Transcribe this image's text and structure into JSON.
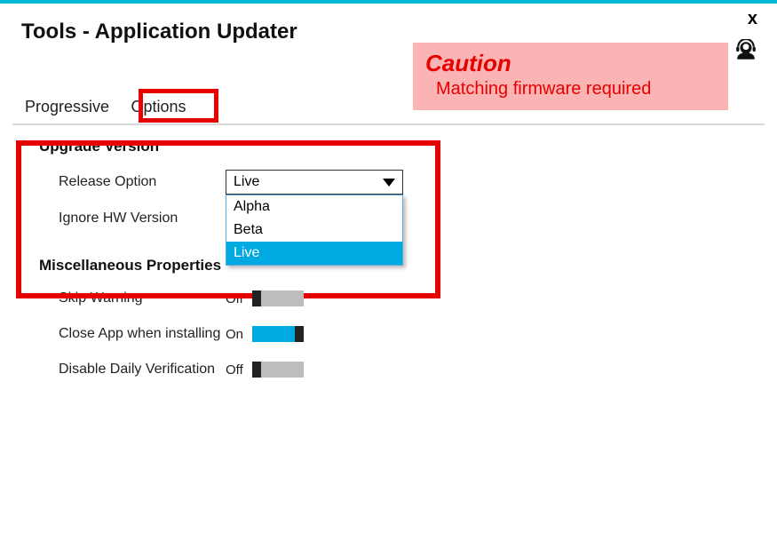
{
  "window": {
    "title": "Tools - Application Updater",
    "close": "x"
  },
  "caution": {
    "title": "Caution",
    "text": "Matching firmware required"
  },
  "tabs": {
    "progressive": "Progressive",
    "options": "Options"
  },
  "sections": {
    "upgrade_version": "Upgrade Version",
    "misc_props": "Miscellaneous Properties"
  },
  "fields": {
    "release_option": {
      "label": "Release Option",
      "value": "Live",
      "options": [
        "Alpha",
        "Beta",
        "Live"
      ]
    },
    "ignore_hw": {
      "label": "Ignore HW Version"
    }
  },
  "toggles": {
    "skip_warning": {
      "label": "Skip Warning",
      "state": "Off",
      "on": false
    },
    "close_app": {
      "label": "Close App when installing",
      "state": "On",
      "on": true
    },
    "disable_daily": {
      "label": "Disable Daily Verification",
      "state": "Off",
      "on": false
    }
  }
}
